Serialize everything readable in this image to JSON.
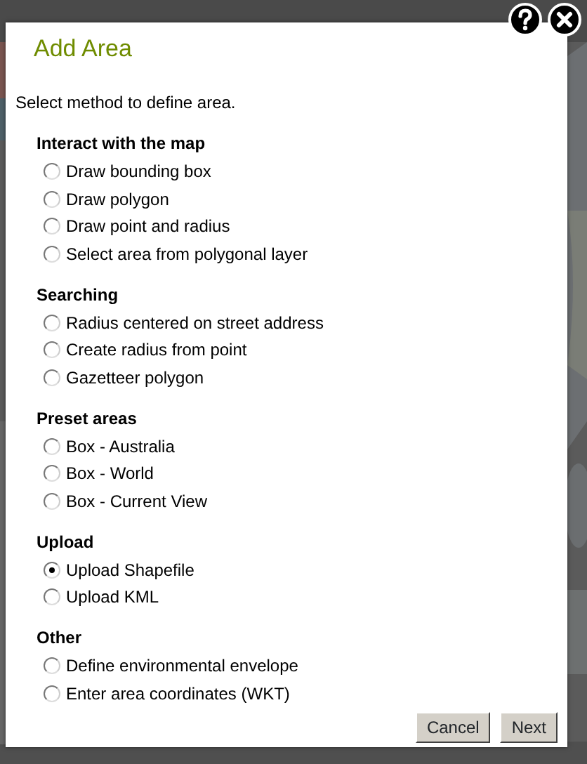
{
  "dialog": {
    "title": "Add Area",
    "intro": "Select method to define area.",
    "sections": [
      {
        "heading": "Interact with the map",
        "options": [
          {
            "label": "Draw bounding box",
            "selected": false
          },
          {
            "label": "Draw polygon",
            "selected": false
          },
          {
            "label": "Draw point and radius",
            "selected": false
          },
          {
            "label": "Select area from polygonal layer",
            "selected": false
          }
        ]
      },
      {
        "heading": "Searching",
        "options": [
          {
            "label": "Radius centered on street address",
            "selected": false
          },
          {
            "label": "Create radius from point",
            "selected": false
          },
          {
            "label": "Gazetteer polygon",
            "selected": false
          }
        ]
      },
      {
        "heading": "Preset areas",
        "options": [
          {
            "label": "Box - Australia",
            "selected": false
          },
          {
            "label": "Box - World",
            "selected": false
          },
          {
            "label": "Box - Current View",
            "selected": false
          }
        ]
      },
      {
        "heading": "Upload",
        "options": [
          {
            "label": "Upload Shapefile",
            "selected": true
          },
          {
            "label": "Upload KML",
            "selected": false
          }
        ]
      },
      {
        "heading": "Other",
        "options": [
          {
            "label": "Define environmental envelope",
            "selected": false
          },
          {
            "label": "Enter area coordinates (WKT)",
            "selected": false
          }
        ]
      }
    ],
    "buttons": [
      {
        "label": "Cancel"
      },
      {
        "label": "Next"
      }
    ]
  }
}
